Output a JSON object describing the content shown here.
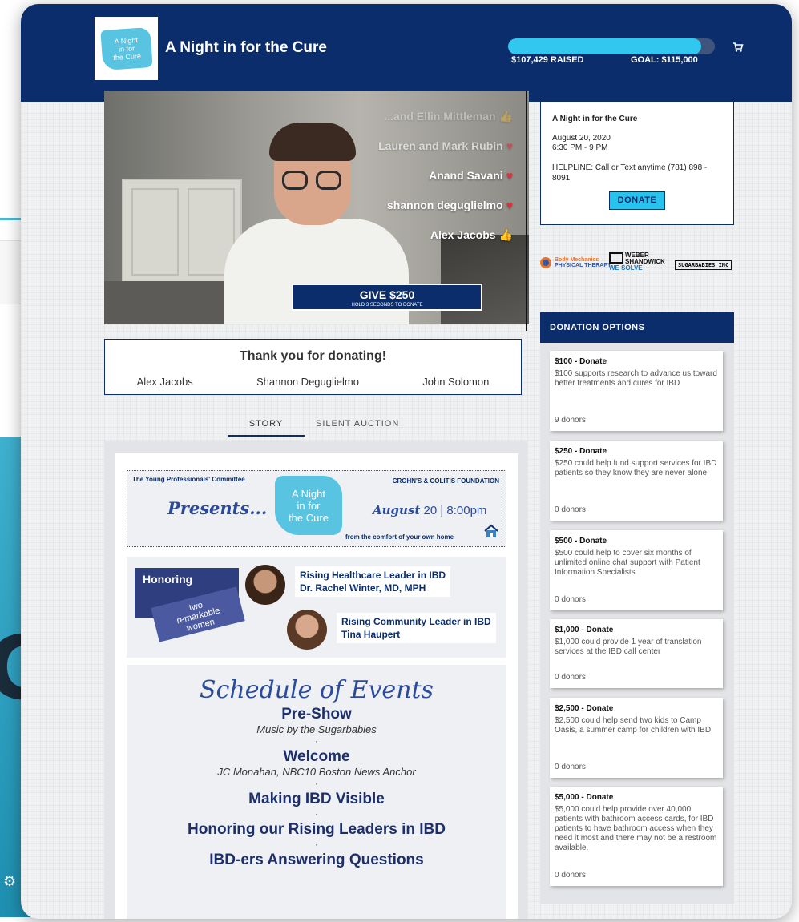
{
  "header": {
    "logo_lines": [
      "A Night",
      "in for",
      "the Cure"
    ],
    "title": "A Night in for the Cure",
    "raised": "$107,429 RAISED",
    "goal": "GOAL: $115,000",
    "progress_fraction": 0.934,
    "cart_icon": "cart-icon"
  },
  "video": {
    "donors": [
      {
        "name": "...and Ellin Mittleman",
        "emoji": "thumbs-up"
      },
      {
        "name": "Lauren and Mark Rubin",
        "emoji": "heart"
      },
      {
        "name": "Anand Savani",
        "emoji": "heart"
      },
      {
        "name": "shannon deguglielmo",
        "emoji": "heart"
      },
      {
        "name": "Alex Jacobs",
        "emoji": "thumbs-up"
      }
    ],
    "give_label": "GIVE $250",
    "give_sublabel": "HOLD 3 SECONDS TO DONATE"
  },
  "thanks": {
    "title": "Thank you for donating!",
    "names": [
      "Alex Jacobs",
      "Shannon Deguglielmo",
      "John Solomon"
    ]
  },
  "tabs": [
    {
      "label": "STORY",
      "active": true
    },
    {
      "label": "SILENT AUCTION",
      "active": false
    }
  ],
  "banner": {
    "committee": "The Young Professionals' Committee",
    "presents": "Presents...",
    "blob_lines": [
      "A Night",
      "in for",
      "the Cure"
    ],
    "date": "August",
    "date_rest": "20 | 8:00pm",
    "crohns": "CROHN'S & COLITIS FOUNDATION",
    "home": "from the comfort of your own home"
  },
  "honoring": {
    "label": "Honoring",
    "ribbon_lines": [
      "two",
      "remarkable",
      "women"
    ],
    "leader_a_role": "Rising Healthcare Leader in IBD",
    "leader_a_name": "Dr. Rachel Winter, MD, MPH",
    "leader_b_role": "Rising Community Leader in IBD",
    "leader_b_name": "Tina Haupert"
  },
  "schedule": {
    "title": "Schedule of Events",
    "items": [
      {
        "title": "Pre-Show",
        "sub": "Music by the Sugarbabies"
      },
      {
        "title": "Welcome",
        "sub": "JC Monahan, NBC10 Boston News Anchor"
      },
      {
        "title": "Making IBD Visible",
        "sub": ""
      },
      {
        "title": "Honoring our Rising Leaders in IBD",
        "sub": ""
      },
      {
        "title": "IBD-ers Answering Questions",
        "sub": ""
      }
    ]
  },
  "event": {
    "title": "A Night in for the Cure",
    "date": "August 20, 2020",
    "time": "6:30 PM - 9 PM",
    "helpline": "HELPLINE: Call or Text anytime (781) 898 - 8091",
    "donate_label": "DONATE"
  },
  "sponsors": {
    "body_mechanics": "Body Mechanics",
    "body_mechanics_sub": "PHYSICAL THERAPY",
    "weber_1": "WEBER",
    "weber_2": "SHANDWICK",
    "weber_3": "WE SOLVE",
    "sugarbabies": "SUGARBABIES INC"
  },
  "donation": {
    "header": "DONATION OPTIONS",
    "options": [
      {
        "title": "$100 - Donate",
        "desc": "$100 supports research to advance us toward better treatments and cures for IBD",
        "donors": "9 donors"
      },
      {
        "title": "$250 - Donate",
        "desc": "$250 could help fund support services for IBD patients so they know they are never alone",
        "donors": "0 donors"
      },
      {
        "title": "$500 - Donate",
        "desc": "$500 could help to cover six months of unlimited online chat support with Patient Information Specialists",
        "donors": "0 donors"
      },
      {
        "title": "$1,000 - Donate",
        "desc": "$1,000 could provide 1 year of translation services at the IBD call center",
        "donors": "0 donors"
      },
      {
        "title": "$2,500 - Donate",
        "desc": "$2,500 could help send two kids to Camp Oasis, a summer camp for children with IBD",
        "donors": "0 donors"
      },
      {
        "title": "$5,000 - Donate",
        "desc": "$5,000 could help provide over 40,000 patients with bathroom access cards, for IBD patients to have bathroom access when they need it most and there may not be a restroom available.",
        "donors": "0 donors"
      }
    ]
  },
  "colors": {
    "navy": "#0b2d6b",
    "accent": "#31c7ee",
    "progress_track": "#40557d"
  }
}
